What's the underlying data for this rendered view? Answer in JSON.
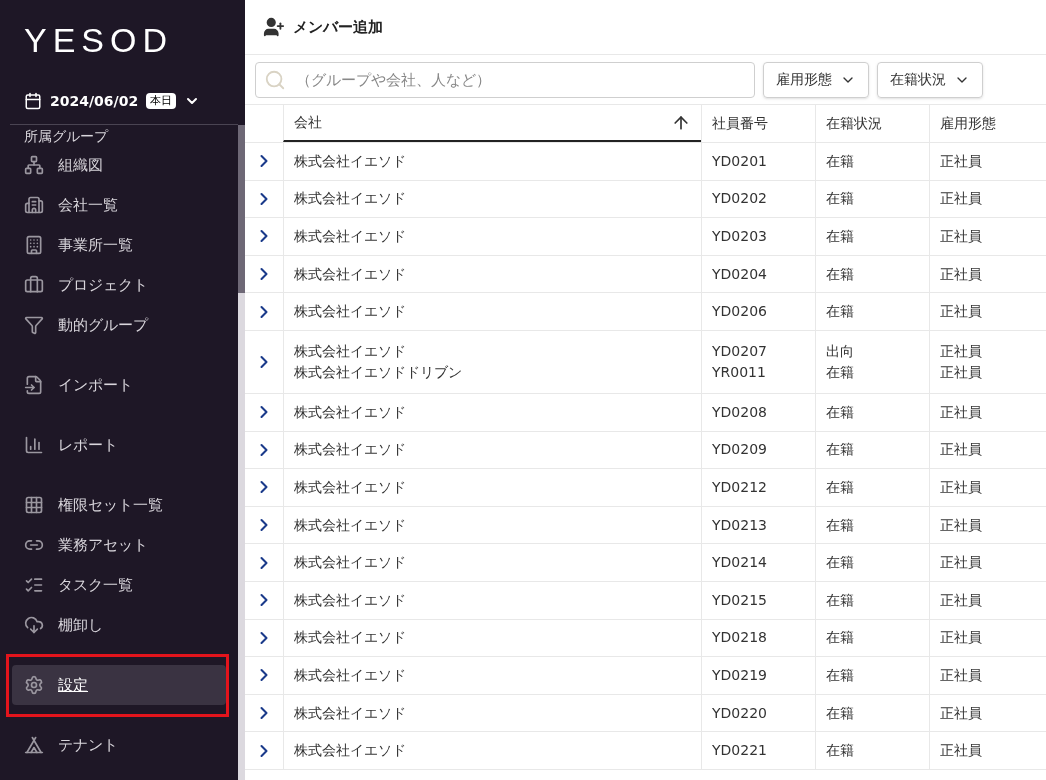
{
  "sidebar": {
    "logo": "YESOD",
    "date": "2024/06/02",
    "today_badge": "本日",
    "section_label": "所属グループ",
    "groups": [
      [
        {
          "label": "組織図",
          "selected": false
        },
        {
          "label": "会社一覧",
          "selected": false
        },
        {
          "label": "事業所一覧",
          "selected": false
        },
        {
          "label": "プロジェクト",
          "selected": false
        },
        {
          "label": "動的グループ",
          "selected": false
        }
      ],
      [
        {
          "label": "インポート",
          "selected": false
        }
      ],
      [
        {
          "label": "レポート",
          "selected": false
        }
      ],
      [
        {
          "label": "権限セット一覧",
          "selected": false
        },
        {
          "label": "業務アセット",
          "selected": false
        },
        {
          "label": "タスク一覧",
          "selected": false
        },
        {
          "label": "棚卸し",
          "selected": false
        }
      ],
      [
        {
          "label": "設定",
          "selected": true
        }
      ],
      [
        {
          "label": "テナント",
          "selected": false
        }
      ]
    ]
  },
  "header": {
    "add_member": "メンバー追加"
  },
  "search": {
    "placeholder": "（グループや会社、人など）"
  },
  "filters": [
    "雇用形態",
    "在籍状況"
  ],
  "table": {
    "columns": [
      {
        "label": "会社",
        "sorted": true
      },
      {
        "label": "社員番号",
        "sorted": false
      },
      {
        "label": "在籍状況",
        "sorted": false
      },
      {
        "label": "雇用形態",
        "sorted": false
      }
    ],
    "rows": [
      [
        [
          "株式会社イエソド",
          "YD0201",
          "在籍",
          "正社員"
        ]
      ],
      [
        [
          "株式会社イエソド",
          "YD0202",
          "在籍",
          "正社員"
        ]
      ],
      [
        [
          "株式会社イエソド",
          "YD0203",
          "在籍",
          "正社員"
        ]
      ],
      [
        [
          "株式会社イエソド",
          "YD0204",
          "在籍",
          "正社員"
        ]
      ],
      [
        [
          "株式会社イエソド",
          "YD0206",
          "在籍",
          "正社員"
        ]
      ],
      [
        [
          "株式会社イエソド",
          "YD0207",
          "出向",
          "正社員"
        ],
        [
          "株式会社イエソドドリブン",
          "YR0011",
          "在籍",
          "正社員"
        ]
      ],
      [
        [
          "株式会社イエソド",
          "YD0208",
          "在籍",
          "正社員"
        ]
      ],
      [
        [
          "株式会社イエソド",
          "YD0209",
          "在籍",
          "正社員"
        ]
      ],
      [
        [
          "株式会社イエソド",
          "YD0212",
          "在籍",
          "正社員"
        ]
      ],
      [
        [
          "株式会社イエソド",
          "YD0213",
          "在籍",
          "正社員"
        ]
      ],
      [
        [
          "株式会社イエソド",
          "YD0214",
          "在籍",
          "正社員"
        ]
      ],
      [
        [
          "株式会社イエソド",
          "YD0215",
          "在籍",
          "正社員"
        ]
      ],
      [
        [
          "株式会社イエソド",
          "YD0218",
          "在籍",
          "正社員"
        ]
      ],
      [
        [
          "株式会社イエソド",
          "YD0219",
          "在籍",
          "正社員"
        ]
      ],
      [
        [
          "株式会社イエソド",
          "YD0220",
          "在籍",
          "正社員"
        ]
      ],
      [
        [
          "株式会社イエソド",
          "YD0221",
          "在籍",
          "正社員"
        ]
      ]
    ]
  }
}
